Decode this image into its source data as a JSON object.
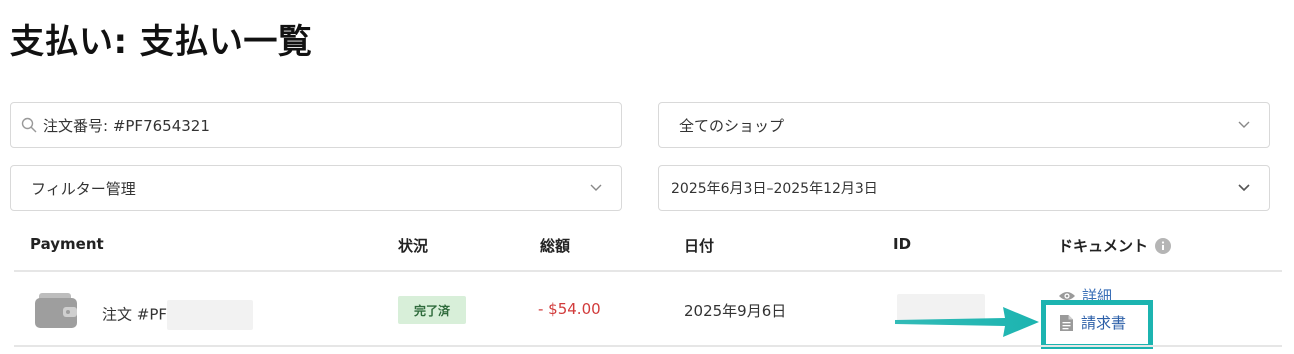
{
  "page_title": "支払い: 支払い一覧",
  "search": {
    "value": "注文番号: #PF7654321"
  },
  "shop_select": {
    "selected": "全てのショップ"
  },
  "filter_select": {
    "selected": "フィルター管理"
  },
  "date_select": {
    "selected": "2025年6月3日–2025年12月3日"
  },
  "table": {
    "headers": [
      "Payment",
      "状況",
      "総額",
      "日付",
      "ID",
      "ドキュメント"
    ],
    "rows": [
      {
        "order_label": "注文 #PF",
        "status": "完了済",
        "amount": "- $54.00",
        "date": "2025年9月6日",
        "detail_link": "詳細",
        "invoice_link": "請求書"
      }
    ]
  },
  "colors": {
    "amount_negative": "#d13b3b",
    "status_bg": "#d8efd9",
    "highlight": "#1cb4b0",
    "link": "#2c5fa8"
  },
  "icons": [
    "search-icon",
    "chevron-down-icon",
    "info-icon",
    "wallet-icon",
    "eye-icon",
    "document-icon",
    "arrow-icon"
  ]
}
